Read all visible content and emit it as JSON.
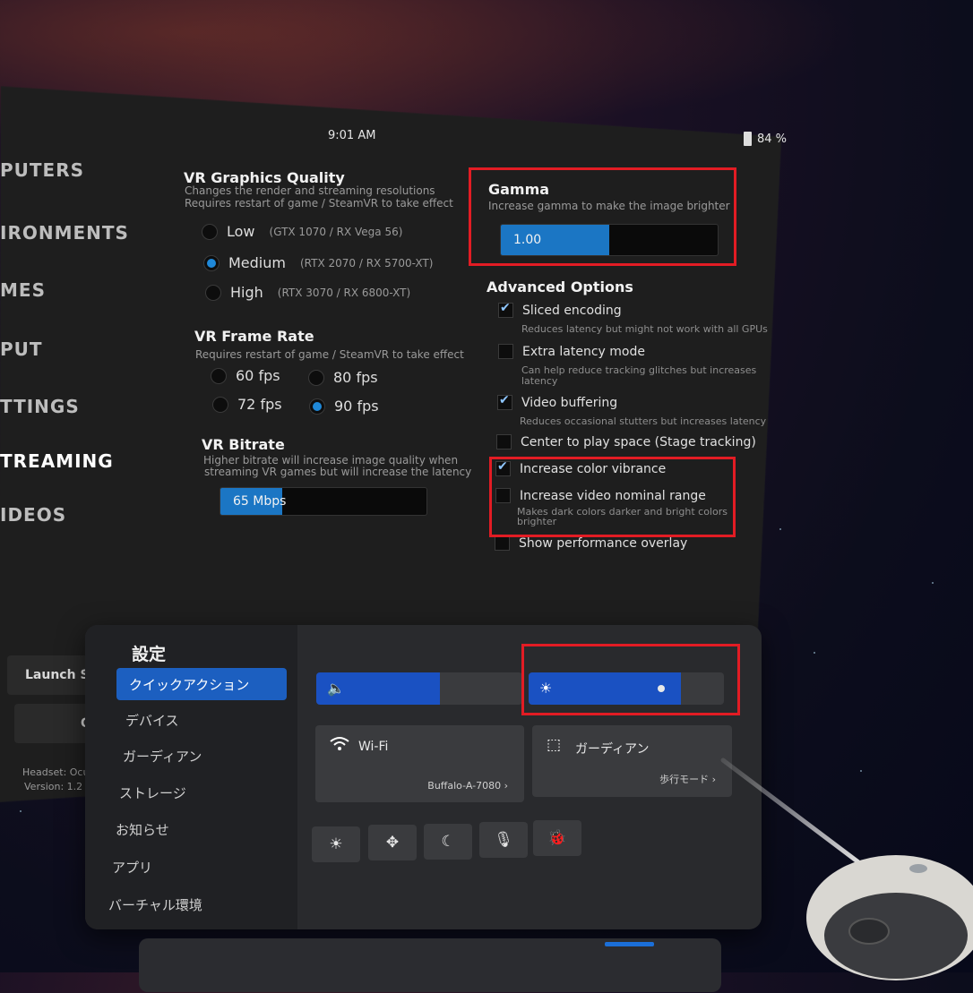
{
  "topbar": {
    "time": "9:01 AM",
    "battery": "84 %"
  },
  "sidebar": {
    "items": [
      {
        "label": "PUTERS"
      },
      {
        "label": "IRONMENTS"
      },
      {
        "label": "MES"
      },
      {
        "label": "PUT"
      },
      {
        "label": "TTINGS"
      },
      {
        "label": "TREAMING"
      },
      {
        "label": "IDEOS"
      }
    ],
    "launch_label": "Launch Ste",
    "quit_label": "Qu",
    "headset_label": "Headset: Ocu",
    "version_label": "Version: 1.2"
  },
  "vr_quality": {
    "title": "VR Graphics Quality",
    "desc1": "Changes the render and streaming resolutions",
    "desc2": "Requires restart of game / SteamVR to take effect",
    "options": [
      {
        "label": "Low",
        "note": "(GTX 1070 / RX Vega 56)"
      },
      {
        "label": "Medium",
        "note": "(RTX 2070 / RX 5700-XT)"
      },
      {
        "label": "High",
        "note": "(RTX 3070 / RX 6800-XT)"
      }
    ],
    "selected": "Medium"
  },
  "frame_rate": {
    "title": "VR Frame Rate",
    "desc": "Requires restart of game / SteamVR to take effect",
    "options": [
      "60 fps",
      "80 fps",
      "72 fps",
      "90 fps"
    ],
    "selected": "90 fps"
  },
  "bitrate": {
    "title": "VR Bitrate",
    "desc1": "Higher bitrate will increase image quality when",
    "desc2": "streaming VR games but will increase the latency",
    "value": "65 Mbps",
    "fill_fraction": 0.3
  },
  "gamma": {
    "title": "Gamma",
    "desc": "Increase gamma to make the image brighter",
    "value": "1.00",
    "fill_fraction": 0.5
  },
  "advanced": {
    "title": "Advanced Options",
    "options": [
      {
        "label": "Sliced encoding",
        "sub": "Reduces latency but might not work with all GPUs",
        "checked": true
      },
      {
        "label": "Extra latency mode",
        "sub1": "Can help reduce tracking glitches but increases",
        "sub2": "latency",
        "checked": false
      },
      {
        "label": "Video buffering",
        "sub": "Reduces occasional stutters but increases latency",
        "checked": true
      },
      {
        "label": "Center to play space (Stage tracking)",
        "checked": false
      },
      {
        "label": "Increase color vibrance",
        "checked": true
      },
      {
        "label": "Increase video nominal range",
        "sub1": "Makes dark colors darker and bright colors",
        "sub2": "brighter",
        "checked": false
      },
      {
        "label": "Show performance overlay",
        "checked": false
      }
    ]
  },
  "oculus": {
    "title": "設定",
    "menu": [
      "クイックアクション",
      "デバイス",
      "ガーディアン",
      "ストレージ",
      "お知らせ",
      "アプリ",
      "バーチャル環境"
    ],
    "volume_fill": 0.6,
    "brightness_fill": 0.78,
    "wifi": {
      "label": "Wi-Fi",
      "network": "Buffalo-A-7080"
    },
    "guardian": {
      "label": "ガーディアン",
      "mode": "歩行モード"
    }
  },
  "colors": {
    "accent": "#1b76c4",
    "highlight": "#e21c24",
    "oculus_blue": "#1a51c2"
  }
}
